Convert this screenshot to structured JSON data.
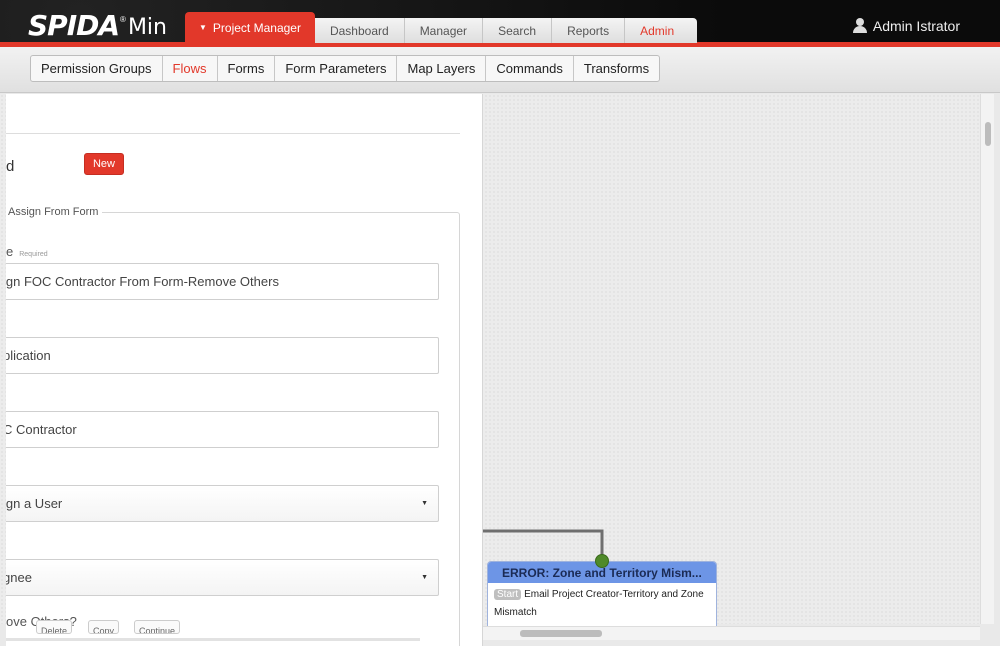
{
  "header": {
    "logo_main": "SPIDA",
    "logo_reg": "®",
    "logo_min": "Min",
    "tabs": [
      {
        "label": "Project Manager",
        "active": true
      },
      {
        "label": "Dashboard"
      },
      {
        "label": "Manager"
      },
      {
        "label": "Search"
      },
      {
        "label": "Reports"
      },
      {
        "label": "Admin"
      }
    ],
    "user_name": "Admin Istrator"
  },
  "subnav": {
    "tabs": [
      {
        "label": "Permission Groups"
      },
      {
        "label": "Flows",
        "active": true
      },
      {
        "label": "Forms"
      },
      {
        "label": "Form Parameters"
      },
      {
        "label": "Map Layers"
      },
      {
        "label": "Commands"
      },
      {
        "label": "Transforms"
      }
    ]
  },
  "panel": {
    "partial_label": "d",
    "new_button": "New",
    "legend": "Assign From Form",
    "name_label_partial": "e",
    "required": "Required",
    "name_value": "ign FOC Contractor From Form-Remove Others",
    "field2_value": "plication",
    "field3_value": "C Contractor",
    "select1_value": "ign a User",
    "select2_value": "gnee",
    "remove_others_label": "ove Others?",
    "mini_buttons": [
      "Delete",
      "Copy",
      "Continue"
    ]
  },
  "flow_node": {
    "title": "ERROR: Zone and Territory Mism...",
    "badge": "Start",
    "description": "Email Project Creator-Territory and Zone Mismatch"
  },
  "colors": {
    "brand_red": "#e2382a",
    "node_header": "#6d95e6",
    "node_dot": "#4f8a2a"
  }
}
